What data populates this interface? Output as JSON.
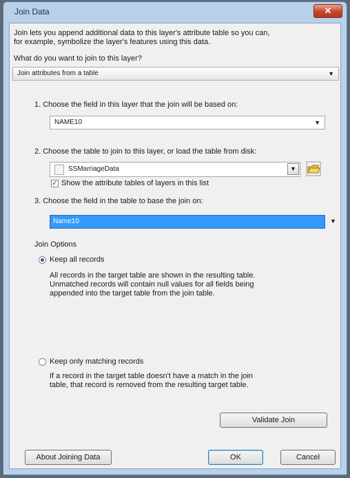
{
  "window": {
    "title": "Join Data",
    "close_glyph": "✕"
  },
  "intro": {
    "line1": "Join lets you append additional data to this layer's attribute table so you can,",
    "line2": "for example, symbolize the layer's features using this data."
  },
  "join_type": {
    "prompt": "What do you want to join to this layer?",
    "selected": "Join attributes from a table"
  },
  "step1": {
    "label": "1.  Choose the field in this layer that the join will be based on:",
    "selected": "NAME10"
  },
  "step2": {
    "label": "2.  Choose the table to join to this layer, or load the table from disk:",
    "selected": "SSMarriageData",
    "show_layers_label": "Show the attribute tables of layers in this list",
    "show_layers_checked": true
  },
  "step3": {
    "label": "3.  Choose the field in the table to base the join on:",
    "selected": "Name10"
  },
  "join_options": {
    "heading": "Join Options",
    "keep_all": {
      "label": "Keep all records",
      "selected": true,
      "desc1": "All records in the target table are shown in the resulting table.",
      "desc2": "Unmatched records will contain null values for all fields being",
      "desc3": "appended into the target table from the join table."
    },
    "keep_matching": {
      "label": "Keep only matching records",
      "selected": false,
      "desc1": "If a record in the target table doesn't have a match in the join",
      "desc2": "table, that record is removed from the resulting target table."
    }
  },
  "buttons": {
    "validate": "Validate Join",
    "about": "About Joining Data",
    "ok": "OK",
    "cancel": "Cancel"
  },
  "colors": {
    "selection": "#3399ff",
    "title_bar": "#b9d1ea",
    "close": "#c7452a"
  }
}
